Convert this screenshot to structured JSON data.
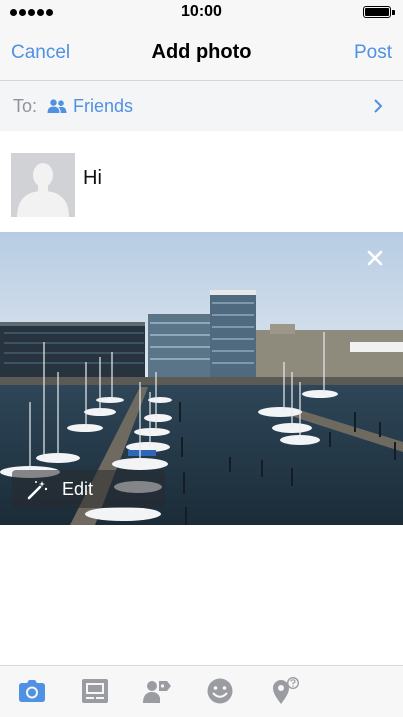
{
  "status_bar": {
    "time": "10:00",
    "signal_dots": 5
  },
  "nav": {
    "cancel_label": "Cancel",
    "title": "Add photo",
    "post_label": "Post"
  },
  "audience": {
    "to_label": "To:",
    "value": "Friends",
    "icon": "friends-icon"
  },
  "composer": {
    "text": "Hi",
    "avatar": "default-profile-silhouette"
  },
  "photo": {
    "subject": "harbor with sailboats and modern office buildings",
    "edit_label": "Edit",
    "remove_icon": "close-icon",
    "edit_icon": "magic-wand-icon"
  },
  "toolbar": {
    "items": [
      {
        "icon": "camera-icon",
        "active": true
      },
      {
        "icon": "photo-album-icon",
        "active": false
      },
      {
        "icon": "tag-people-icon",
        "active": false
      },
      {
        "icon": "smiley-icon",
        "active": false
      },
      {
        "icon": "location-pin-icon",
        "active": false
      }
    ]
  },
  "colors": {
    "accent": "#4f91e2",
    "inactive_icon": "#9a9ca1",
    "bar_bg": "#f7f7f8"
  }
}
